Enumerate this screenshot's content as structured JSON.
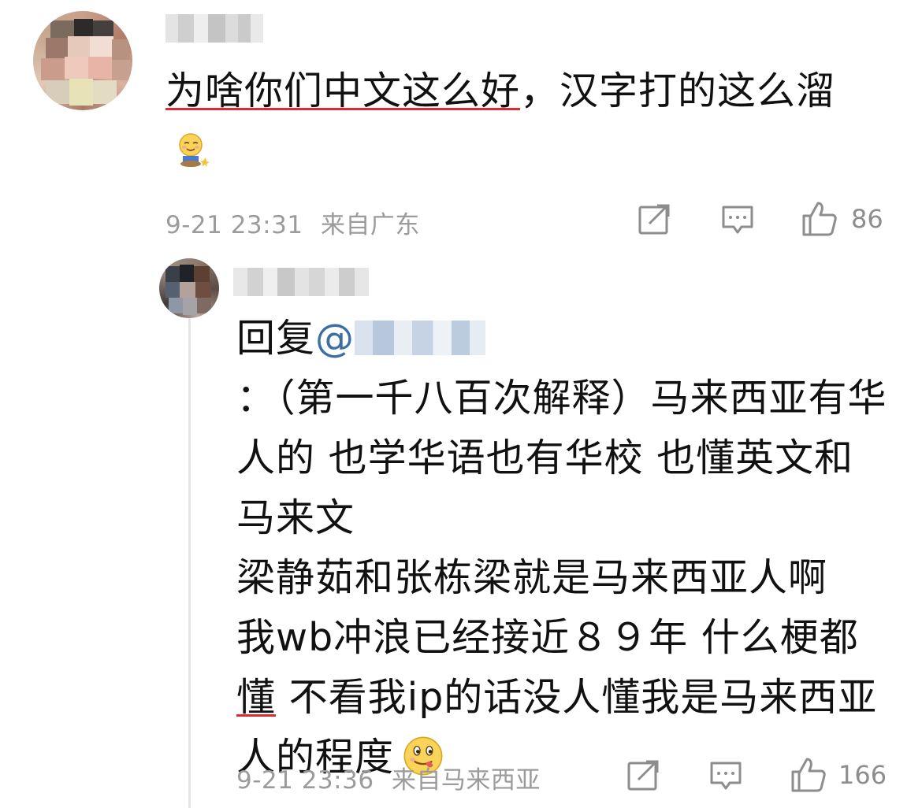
{
  "main_comment": {
    "text_underlined": "为啥你们中文这么好",
    "text_rest": "，汉字打的这么溜",
    "timestamp": "9-21 23:31",
    "location": "来自广东",
    "like_count": "86",
    "icons": {
      "share": "share-icon",
      "comment": "comment-icon",
      "like": "thumbs-up-icon"
    }
  },
  "reply_comment": {
    "reply_prefix": "回复",
    "mention_at": "@",
    "mention_suffix": "：（第一千八百次解释）",
    "seg_underline_1": "马来西亚有华人的 也学华语也有华校 也懂英文和马来文",
    "seg_plain_1": "梁静茹和张栋梁就是马来西亚人啊 ",
    "seg_underline_2": "我wb冲浪已经接近８９年 什么梗都懂",
    "seg_plain_2": " 不看我ip的话没人懂我是马来西亚人的程度",
    "timestamp": "9-21 23:36",
    "location": "来自马来西亚",
    "like_count": "166",
    "icons": {
      "share": "share-icon",
      "comment": "comment-icon",
      "like": "thumbs-up-icon"
    }
  },
  "colors": {
    "underline": "#e02a33",
    "mention": "#3a6ea5",
    "meta_text": "#9b9b9b",
    "thread_line": "#e6e6e6"
  }
}
